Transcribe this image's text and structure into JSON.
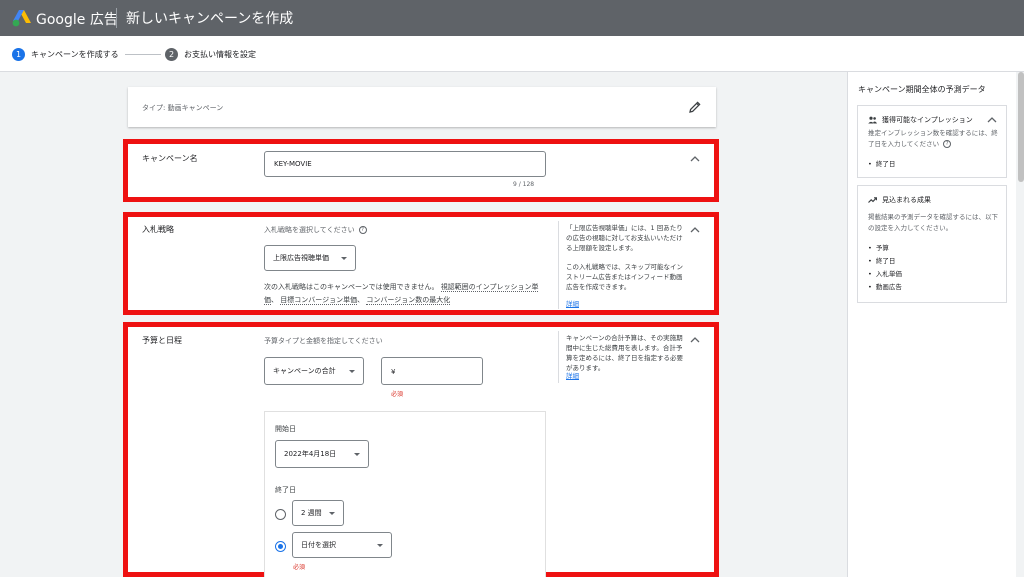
{
  "header": {
    "brand": "Google 広告",
    "page_title": "新しいキャンペーンを作成",
    "logo_icon": "google-ads-logo",
    "bar_color": "#5f6368"
  },
  "steps": [
    {
      "number": "1",
      "label": "キャンペーンを作成する",
      "state": "active"
    },
    {
      "number": "2",
      "label": "お支払い情報を設定",
      "state": "inactive"
    }
  ],
  "type_card": {
    "label": "タイプ: 動画キャンペーン",
    "edit_icon": "pencil-icon"
  },
  "campaign_name": {
    "label": "キャンペーン名",
    "value": "KEY-MOVIE",
    "counter": "9 / 128"
  },
  "bidding": {
    "label": "入札戦略",
    "hint": "入札戦略を選択してください",
    "dropdown_value": "上限広告視聴単価",
    "note_text": "次の入札戦略はこのキャンペーンでは使用できません。",
    "note_links": [
      "視認範囲のインプレッション単価",
      "目標コンバージョン単価",
      "コンバージョン数の最大化"
    ],
    "side_note_1": "「上限広告視聴単価」には、1 回あたりの広告の視聴に対してお支払いいただける上限額を設定します。",
    "side_note_2": "この入札戦略では、スキップ可能なインストリーム広告またはインフィード動画広告を作成できます。",
    "side_link": "詳細"
  },
  "budget": {
    "label": "予算と日程",
    "hint": "予算タイプと金額を指定してください",
    "type_dropdown": "キャンペーンの合計",
    "currency_symbol": "¥",
    "required": "必須",
    "side_note": "キャンペーンの合計予算は、その実施期間中に生じた総費用を表します。合計予算を定めるには、終了日を指定する必要があります。",
    "side_link": "詳細",
    "start_date_label": "開始日",
    "start_date_value": "2022年4月18日",
    "end_date_label": "終了日",
    "end_option_1": "2 週間",
    "end_option_2": "日付を選択",
    "end_required": "必須"
  },
  "right_panel": {
    "title": "キャンペーン期間全体の予測データ",
    "impressions": {
      "title": "獲得可能なインプレッション",
      "desc": "推定インプレッション数を確認するには、終了日を入力してください",
      "items": [
        "終了日"
      ]
    },
    "results": {
      "title": "見込まれる成果",
      "desc": "掲載結果の予測データを確認するには、以下の設定を入力してください。",
      "items": [
        "予算",
        "終了日",
        "入札単価",
        "動画広告"
      ]
    }
  },
  "colors": {
    "accent": "#1a73e8",
    "highlight": "#ee1111",
    "error": "#d93025"
  }
}
